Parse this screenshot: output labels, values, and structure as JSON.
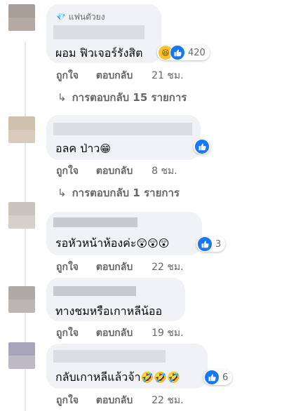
{
  "fan_badge": "แฟนตัวยง",
  "actions": {
    "like": "ถูกใจ",
    "reply": "ตอบกลับ"
  },
  "comments": [
    {
      "text": "ผอม ฟิวเจอร์รังสิต",
      "emoji": "",
      "reaction_count": "420",
      "reactions": [
        "haha-icon",
        "like-icon"
      ],
      "time": "21 ชม.",
      "replies": "การตอบกลับ 15 รายการ",
      "avatar_colors": [
        "#a89e99",
        "#b4a9a3"
      ]
    },
    {
      "text": "อลค ป่าว",
      "emoji": "😁",
      "reaction_count": "",
      "reactions": [
        "like-icon"
      ],
      "time": "8 ชม.",
      "replies": "การตอบกลับ 1 รายการ",
      "avatar_colors": [
        "#cfc0ae",
        "#d8cbbb"
      ]
    },
    {
      "text": "รอหัวหน้าห้องค่ะ",
      "emoji": "😲😲😲",
      "reaction_count": "3",
      "reactions": [
        "like-icon"
      ],
      "time": "22 ชม.",
      "replies": "",
      "avatar_colors": [
        "#c9c3be",
        "#d6d0cb"
      ]
    },
    {
      "text": "ทางชมหรือเกาหลีน้ออ",
      "emoji": "",
      "reaction_count": "",
      "reactions": [],
      "time": "19 ชม.",
      "replies": "",
      "avatar_colors": [
        "#b0aaa7",
        "#bcb6b2"
      ]
    },
    {
      "text": "กลับเกาหลีแล้วจ้า",
      "emoji": "🤣🤣🤣",
      "reaction_count": "6",
      "reactions": [
        "like-icon"
      ],
      "time": "22 ชม.",
      "replies": "",
      "avatar_colors": [
        "#a9a6bb",
        "#bdbac6"
      ]
    }
  ]
}
